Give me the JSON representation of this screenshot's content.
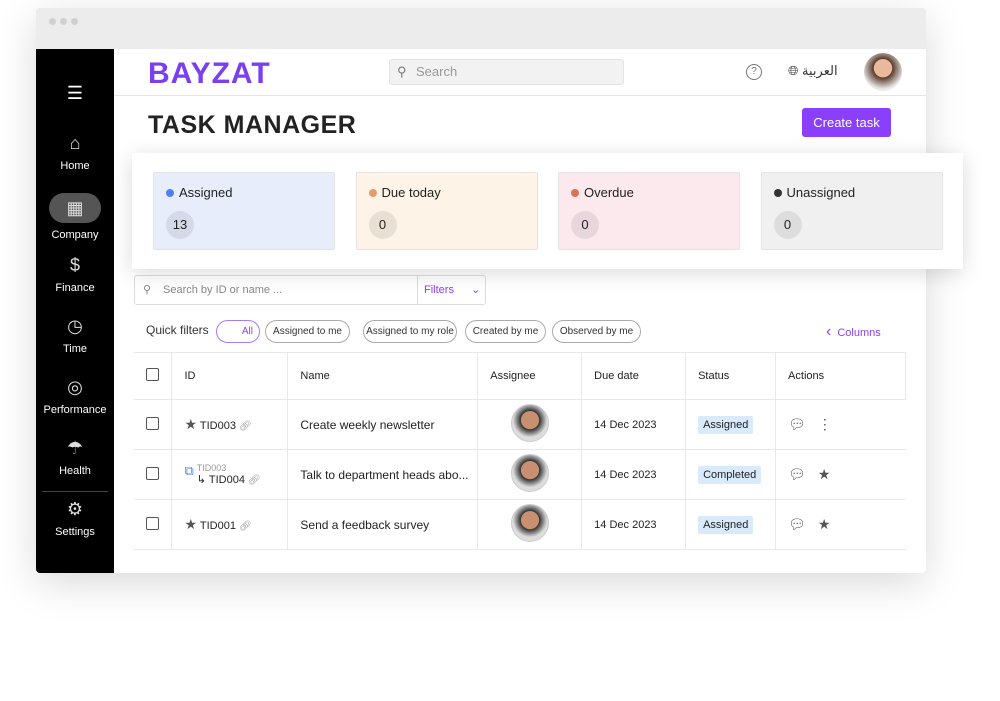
{
  "brand": {
    "logo": "BAYZAT",
    "accent": "#8a3ffc"
  },
  "sidebar": {
    "items": [
      {
        "label": "Home",
        "icon": "home-icon",
        "glyph": "⌂"
      },
      {
        "label": "Company",
        "icon": "building-icon",
        "glyph": "▦",
        "active": true
      },
      {
        "label": "Finance",
        "icon": "dollar-icon",
        "glyph": "$"
      },
      {
        "label": "Time",
        "icon": "clock-icon",
        "glyph": "◷"
      },
      {
        "label": "Performance",
        "icon": "target-icon",
        "glyph": "◎"
      },
      {
        "label": "Health",
        "icon": "umbrella-icon",
        "glyph": "☂"
      },
      {
        "label": "Settings",
        "icon": "gear-icon",
        "glyph": "⚙"
      }
    ]
  },
  "header": {
    "search_placeholder": "Search",
    "language": "العربية"
  },
  "page": {
    "title": "TASK MANAGER",
    "create_label": "Create task"
  },
  "stats": [
    {
      "label": "Assigned",
      "value": "13",
      "dot": "#4f7ff0",
      "bg": "#e8edfc"
    },
    {
      "label": "Due today",
      "value": "0",
      "dot": "#e59a6f",
      "bg": "#fdf3e6"
    },
    {
      "label": "Overdue",
      "value": "0",
      "dot": "#d9735b",
      "bg": "#fbe9ee"
    },
    {
      "label": "Unassigned",
      "value": "0",
      "dot": "#333333",
      "bg": "#f0f0f0"
    }
  ],
  "toolbar": {
    "search_placeholder": "Search by ID or name ...",
    "filters": "Filters",
    "quick_filters": "Quick filters",
    "chips": [
      "All",
      "Assigned to me",
      "Assigned to my role",
      "Created by me",
      "Observed by me"
    ],
    "columns": "Columns"
  },
  "table": {
    "headers": [
      "ID",
      "Name",
      "Assignee",
      "Due date",
      "Status",
      "Actions"
    ],
    "rows": [
      {
        "id": "TID003",
        "parent": "",
        "name": "Create weekly newsletter",
        "due": "14 Dec 2023",
        "status": "Assigned"
      },
      {
        "id": "TID004",
        "parent": "TID003",
        "name": "Talk to department heads abo...",
        "due": "14 Dec 2023",
        "status": "Completed"
      },
      {
        "id": "TID001",
        "parent": "",
        "name": "Send a feedback survey",
        "due": "14 Dec 2023",
        "status": "Assigned"
      }
    ]
  }
}
